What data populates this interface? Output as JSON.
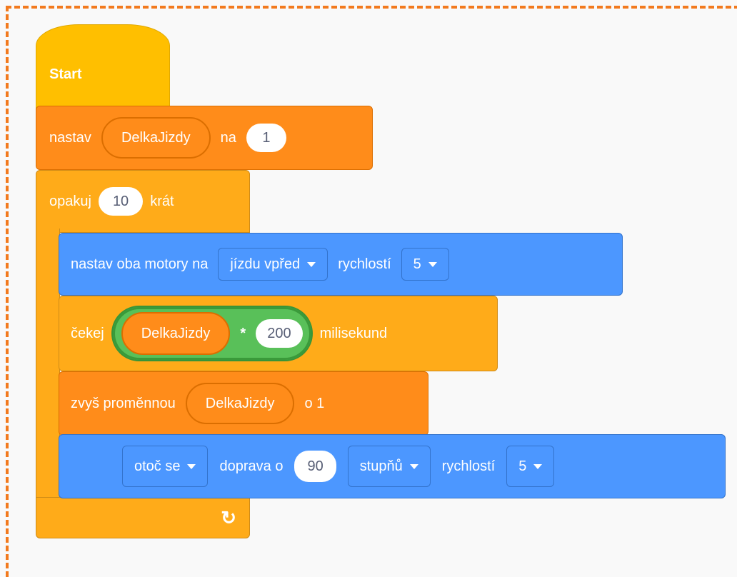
{
  "start": {
    "label": "Start"
  },
  "set_var": {
    "label": "nastav",
    "variable": "DelkaJizdy",
    "to": "na",
    "value": "1"
  },
  "repeat": {
    "label": "opakuj",
    "count": "10",
    "suffix": "krát",
    "loop_icon": "loop-arrow-icon"
  },
  "motors": {
    "label": "nastav oba motory na",
    "direction": "jízdu vpřed",
    "speed_label": "rychlostí",
    "speed": "5"
  },
  "wait": {
    "label": "čekej",
    "variable": "DelkaJizdy",
    "operator": "*",
    "operand": "200",
    "unit": "milisekund"
  },
  "increase": {
    "label": "zvyš proměnnou",
    "variable": "DelkaJizdy",
    "by": "o 1"
  },
  "turn": {
    "action": "otoč se",
    "direction_label": "doprava o",
    "amount": "90",
    "unit": "stupňů",
    "speed_label": "rychlostí",
    "speed": "5"
  }
}
